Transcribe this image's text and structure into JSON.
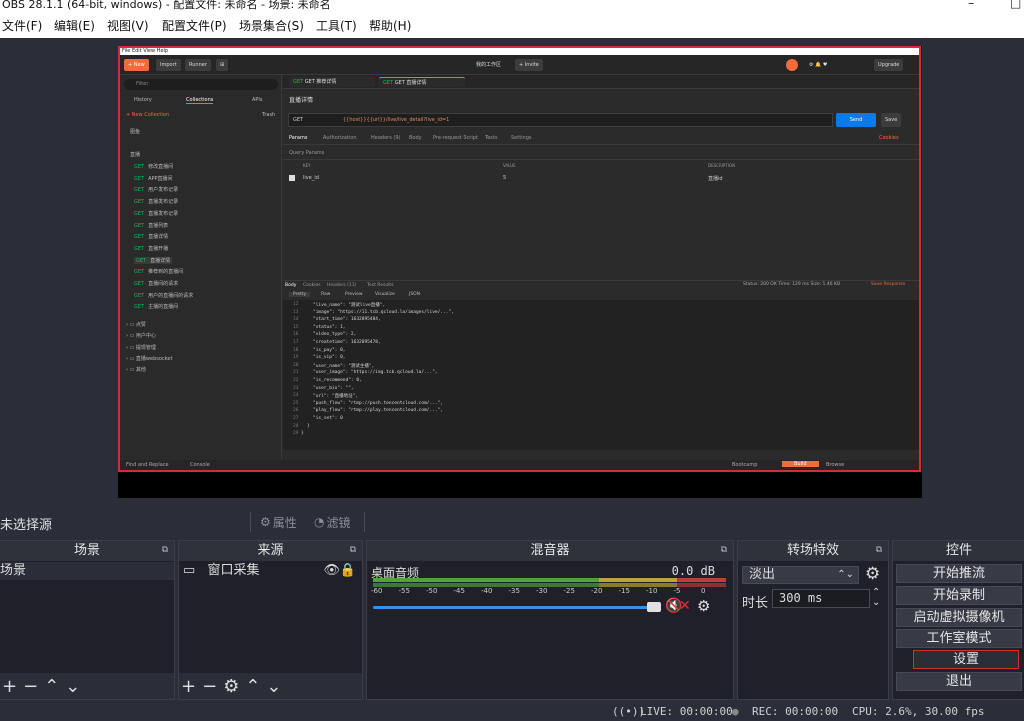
{
  "window": {
    "title": "OBS 28.1.1 (64-bit, windows) - 配置文件: 未命名 - 场景: 未命名"
  },
  "menu": [
    "文件(F)",
    "编辑(E)",
    "视图(V)",
    "配置文件(P)",
    "场景集合(S)",
    "工具(T)",
    "帮助(H)"
  ],
  "capture": {
    "toolbar": {
      "new": "+ New",
      "import": "Import",
      "runner": "Runner",
      "workspace": "我的工作区",
      "invite": "+ Invite",
      "upgrade": "Upgrade"
    },
    "tabs": [
      "GET 推荐详情",
      "GET 直播详情"
    ],
    "request_title": "直播详情",
    "method": "GET",
    "url": "{{host}}{{url}}/live/live_detail?live_id=1",
    "send": "Send",
    "save": "Save",
    "req_tabs": [
      "Params",
      "Authorization",
      "Headers (9)",
      "Body",
      "Pre-request Script",
      "Tests",
      "Settings"
    ],
    "cookies": "Cookies",
    "query_params": "Query Params",
    "param_columns": [
      "KEY",
      "VALUE",
      "DESCRIPTION"
    ],
    "params": [
      {
        "key": "live_id",
        "value": "5",
        "desc": "直播id"
      }
    ],
    "resp_tabs": [
      "Body",
      "Cookies",
      "Headers (11)",
      "Test Results"
    ],
    "resp_status": "Status: 200 OK   Time: 129 ms   Size: 1.46 KB",
    "save_response": "Save Response",
    "view_modes": [
      "Pretty",
      "Raw",
      "Preview",
      "Visualize",
      "JSON"
    ],
    "sidebar": {
      "filter": "Filter",
      "tabs": [
        "History",
        "Collections",
        "APIs"
      ],
      "new_collection": "+ New Collection",
      "trash": "Trash",
      "items": [
        "图鱼",
        "直播",
        "修改直播间",
        "APP直播间",
        "用户发布记录",
        "直播发布记录",
        "直播发布记录",
        "直播列表",
        "直播详情",
        "直播开播",
        "直播详情",
        "推荐到的直播间",
        "直播间的请求",
        "用户的直播间的请求",
        "主播的直播间",
        "点赞",
        "用户中心",
        "提现管理",
        "直播websocket",
        "其他"
      ]
    },
    "code_lines": [
      {
        "n": "12",
        "t": "\"live_name\": \"测试live直播\","
      },
      {
        "n": "13",
        "t": "\"image\": \"https://11.tcb.qcloud.la/images/live/...\","
      },
      {
        "n": "14",
        "t": "\"start_time\": 1632895484,"
      },
      {
        "n": "15",
        "t": "\"status\": 1,"
      },
      {
        "n": "16",
        "t": "\"video_type\": 2,"
      },
      {
        "n": "17",
        "t": "\"createtime\": 1632895478,"
      },
      {
        "n": "18",
        "t": "\"is_pay\": 0,"
      },
      {
        "n": "19",
        "t": "\"is_vip\": 0,"
      },
      {
        "n": "20",
        "t": "\"user_name\": \"测试主播\","
      },
      {
        "n": "21",
        "t": "\"user_image\": \"https://img.tcb.qcloud.la/...\","
      },
      {
        "n": "22",
        "t": "\"is_recommend\": 0,"
      },
      {
        "n": "23",
        "t": "\"user_bio\": \"\","
      },
      {
        "n": "24",
        "t": "\"url\": \"直播地址\","
      },
      {
        "n": "25",
        "t": "\"push_flow\": \"rtmp://push.tencentcloud.com/...\","
      },
      {
        "n": "26",
        "t": "\"play_flow\": \"rtmp://play.tencentcloud.com/...\","
      },
      {
        "n": "27",
        "t": "\"is_set\": 0"
      },
      {
        "n": "28",
        "t": "}"
      },
      {
        "n": "29",
        "t": "}"
      }
    ],
    "footer": {
      "find": "Find and Replace",
      "console": "Console",
      "bootcamp": "Bootcamp",
      "build": "Build",
      "browse": "Browse"
    }
  },
  "status": {
    "no_source": "未选择源",
    "properties": "属性",
    "filters": "滤镜"
  },
  "docks": {
    "scenes": {
      "title": "场景",
      "items": [
        "场景"
      ]
    },
    "sources": {
      "title": "来源",
      "items": [
        "窗口采集"
      ]
    },
    "mixer": {
      "title": "混音器",
      "channel": "桌面音频",
      "db": "0.0 dB",
      "ticks": [
        "-60",
        "-55",
        "-50",
        "-45",
        "-40",
        "-35",
        "-30",
        "-25",
        "-20",
        "-15",
        "-10",
        "-5",
        "0"
      ],
      "volume": 1.0
    },
    "transitions": {
      "title": "转场特效",
      "type": "淡出",
      "duration_label": "时长",
      "duration": "300 ms"
    },
    "controls": {
      "title": "控件",
      "buttons": [
        "开始推流",
        "开始录制",
        "启动虚拟摄像机",
        "工作室模式",
        "设置",
        "退出"
      ]
    }
  },
  "bottom": {
    "live": "LIVE: 00:00:00",
    "rec": "REC: 00:00:00",
    "cpu": "CPU: 2.6%, 30.00 fps"
  },
  "colors": {
    "accent": "#d32f2f",
    "panel": "#1f2029",
    "bg": "#2b2e38",
    "meter_green": "#4fa33b",
    "meter_yellow": "#b9a43d",
    "meter_red": "#b84040",
    "slider": "#3d8de3"
  }
}
